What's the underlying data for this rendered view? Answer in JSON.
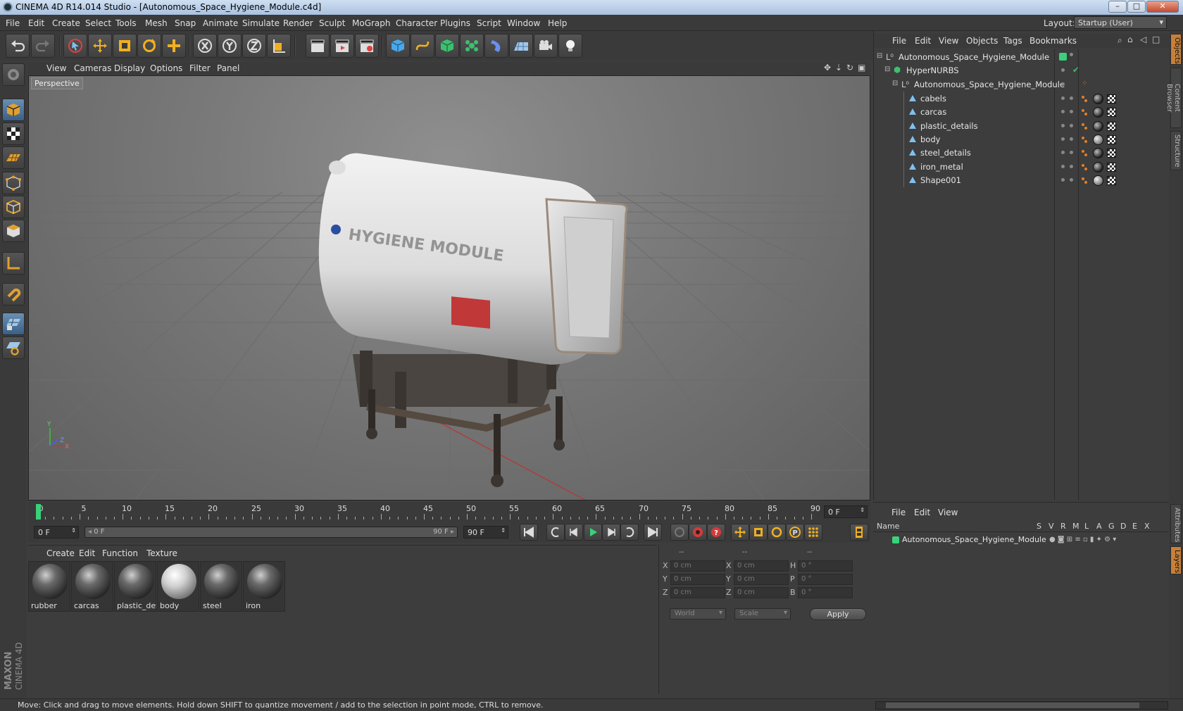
{
  "window": {
    "title": "CINEMA 4D R14.014 Studio - [Autonomous_Space_Hygiene_Module.c4d]"
  },
  "menu": [
    "File",
    "Edit",
    "Create",
    "Select",
    "Tools",
    "Mesh",
    "Snap",
    "Animate",
    "Simulate",
    "Render",
    "Sculpt",
    "MoGraph",
    "Character",
    "Plugins",
    "Script",
    "Window",
    "Help"
  ],
  "layout": {
    "label": "Layout:",
    "value": "Startup (User)"
  },
  "viewport": {
    "menu": [
      "View",
      "Cameras",
      "Display",
      "Options",
      "Filter",
      "Panel"
    ],
    "camera": "Perspective",
    "axis_y": "Y",
    "axis_z": "Z",
    "axis_x": "X"
  },
  "object_manager": {
    "menu": [
      "File",
      "Edit",
      "View",
      "Objects",
      "Tags",
      "Bookmarks"
    ],
    "objects": [
      {
        "name": "Autonomous_Space_Hygiene_Module",
        "level": 0
      },
      {
        "name": "HyperNURBS",
        "level": 1
      },
      {
        "name": "Autonomous_Space_Hygiene_Module",
        "level": 2
      },
      {
        "name": "cabels",
        "level": 3
      },
      {
        "name": "carcas",
        "level": 3
      },
      {
        "name": "plastic_details",
        "level": 3
      },
      {
        "name": "body",
        "level": 3
      },
      {
        "name": "steel_details",
        "level": 3
      },
      {
        "name": "iron_metal",
        "level": 3
      },
      {
        "name": "Shape001",
        "level": 3
      }
    ]
  },
  "side_tabs": [
    "Objects",
    "Content Browser",
    "Structure"
  ],
  "side_tabs_lower": [
    "Attributes",
    "Layers"
  ],
  "timeline": {
    "labels": [
      "0",
      "5",
      "10",
      "15",
      "20",
      "25",
      "30",
      "35",
      "40",
      "45",
      "50",
      "55",
      "60",
      "65",
      "70",
      "75",
      "80",
      "85",
      "90"
    ],
    "current_frame": "0 F",
    "end_field": "0 F",
    "start": "0 F",
    "slider_start": "0 F",
    "slider_end": "90 F",
    "max": "90 F"
  },
  "materials": {
    "menu": [
      "Create",
      "Edit",
      "Function",
      "Texture"
    ],
    "items": [
      "rubber",
      "carcas",
      "plastic_det",
      "body",
      "steel",
      "iron"
    ]
  },
  "coordinates": {
    "headers": [
      "--",
      "--",
      "--"
    ],
    "rows": [
      {
        "a": "X",
        "v1": "0 cm",
        "b": "X",
        "v2": "0 cm",
        "c": "H",
        "v3": "0 °"
      },
      {
        "a": "Y",
        "v1": "0 cm",
        "b": "Y",
        "v2": "0 cm",
        "c": "P",
        "v3": "0 °"
      },
      {
        "a": "Z",
        "v1": "0 cm",
        "b": "Z",
        "v2": "0 cm",
        "c": "B",
        "v3": "0 °"
      }
    ],
    "space": "World",
    "mode": "Scale",
    "apply": "Apply"
  },
  "layers": {
    "menu": [
      "File",
      "Edit",
      "View"
    ],
    "columns": [
      "Name",
      "S",
      "V",
      "R",
      "M",
      "L",
      "A",
      "G",
      "D",
      "E",
      "X"
    ],
    "row": "Autonomous_Space_Hygiene_Module"
  },
  "status": "Move: Click and drag to move elements. Hold down SHIFT to quantize movement / add to the selection in point mode, CTRL to remove.",
  "logo": "MAXON CINEMA 4D",
  "model_label": "HYGIENE MODULE",
  "colors": {
    "accent": "#c6803a",
    "green": "#39d27a",
    "title_bg": "#a9c1df"
  }
}
